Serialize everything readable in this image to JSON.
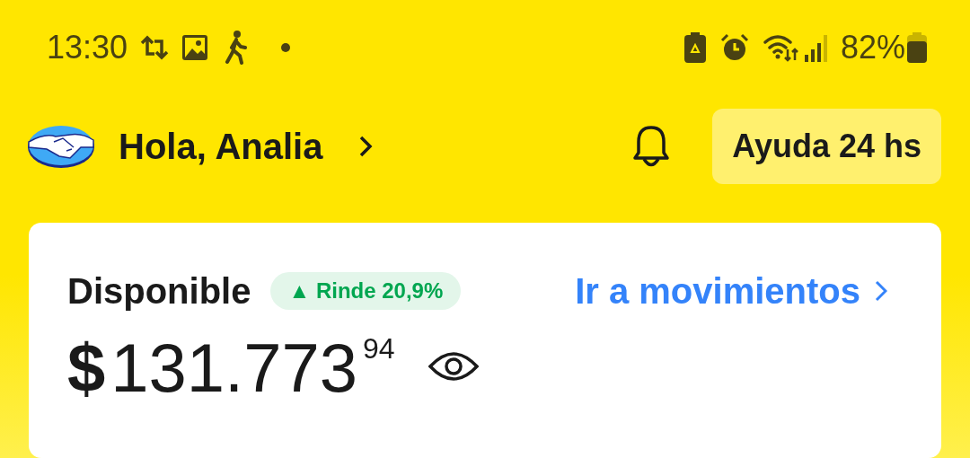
{
  "status_bar": {
    "time": "13:30",
    "battery_percent": "82%"
  },
  "header": {
    "greeting": "Hola, Analia",
    "help_button": "Ayuda 24 hs"
  },
  "balance_card": {
    "label": "Disponible",
    "yield_badge": "▲ Rinde 20,9%",
    "movements_link": "Ir a movimientos",
    "currency": "$",
    "amount": "131.773",
    "cents": "94"
  }
}
